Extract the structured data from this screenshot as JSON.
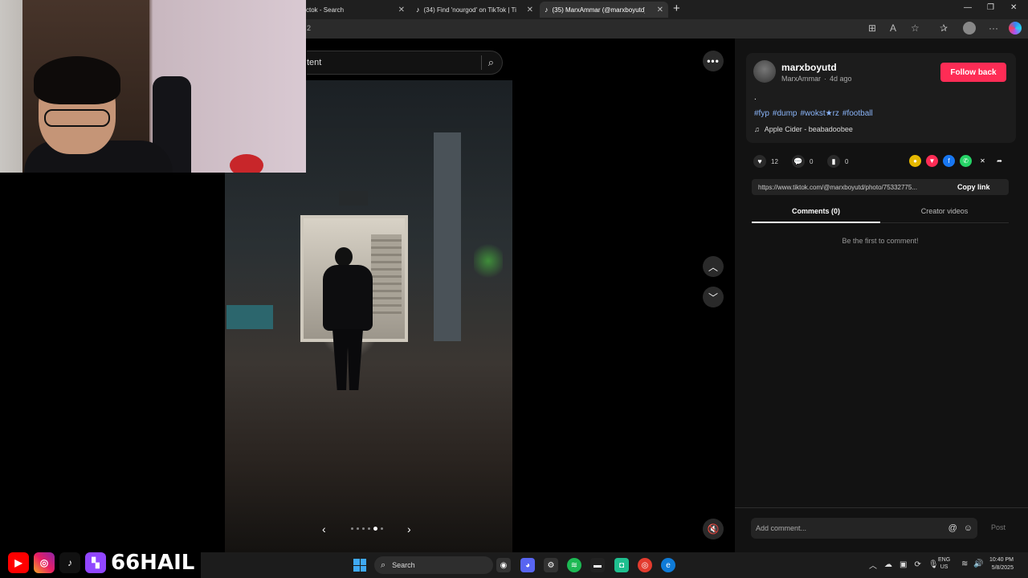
{
  "browser": {
    "tabs": [
      {
        "title": "ctok - Search"
      },
      {
        "title": "(34) Find 'nourgod' on TikTok | Tik"
      },
      {
        "title": "(35) MarxAmmar (@marxboyutd)"
      }
    ],
    "new_tab": "+",
    "address_fragment": "2"
  },
  "page": {
    "search": {
      "text": "tent"
    },
    "carousel": {
      "slides": 6,
      "active_index": 4
    }
  },
  "post": {
    "username": "marxboyutd",
    "display_name": "MarxAmmar",
    "separator": "·",
    "age": "4d ago",
    "follow_label": "Follow back",
    "caption": ".",
    "hashtags": [
      "#fyp",
      "#dump",
      "#wokst★rz",
      "#football"
    ],
    "music": "Apple Cider - beabadoobee",
    "stats": {
      "likes": "12",
      "comments": "0",
      "saves": "0"
    },
    "link": "https://www.tiktok.com/@marxboyutd/photo/75332775...",
    "copy_label": "Copy link",
    "tabs": {
      "comments": "Comments (0)",
      "creator": "Creator videos"
    },
    "empty_comments": "Be the first to comment!",
    "comment_placeholder": "Add comment...",
    "post_label": "Post"
  },
  "overlay": {
    "handle": "66HAIL"
  },
  "taskbar": {
    "search_label": "Search",
    "lang_top": "ENG",
    "lang_bottom": "US",
    "time": "10:40 PM",
    "date": "5/8/2025"
  },
  "colors": {
    "follow": "#fe2c55",
    "hashtag": "#8ab4f8",
    "panel": "#121212"
  }
}
